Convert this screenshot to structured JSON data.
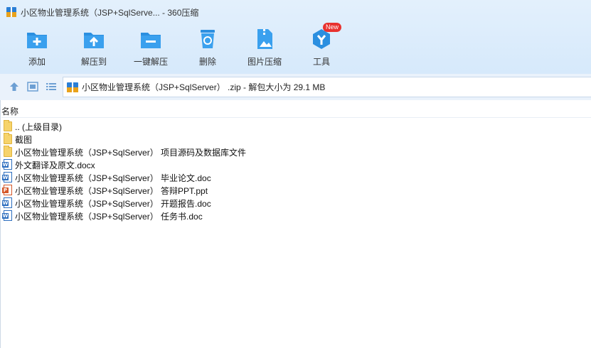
{
  "window": {
    "title": "小区物业管理系统（JSP+SqlServe... - 360压缩"
  },
  "toolbar": {
    "items": [
      {
        "label": "添加",
        "icon": "add-icon"
      },
      {
        "label": "解压到",
        "icon": "extract-to-icon"
      },
      {
        "label": "一键解压",
        "icon": "one-click-extract-icon"
      },
      {
        "label": "删除",
        "icon": "delete-icon"
      },
      {
        "label": "图片压缩",
        "icon": "image-compress-icon"
      },
      {
        "label": "工具",
        "icon": "tools-icon",
        "badge": "New"
      }
    ]
  },
  "address": {
    "text": "小区物业管理系统（JSP+SqlServer） .zip - 解包大小为 29.1 MB"
  },
  "list": {
    "column_header": "名称",
    "rows": [
      {
        "name": ".. (上级目录)",
        "type": "folder"
      },
      {
        "name": "截图",
        "type": "folder"
      },
      {
        "name": "小区物业管理系统（JSP+SqlServer） 项目源码及数据库文件",
        "type": "folder"
      },
      {
        "name": "外文翻译及原文.docx",
        "type": "word"
      },
      {
        "name": "小区物业管理系统（JSP+SqlServer） 毕业论文.doc",
        "type": "word"
      },
      {
        "name": "小区物业管理系统（JSP+SqlServer） 答辩PPT.ppt",
        "type": "ppt"
      },
      {
        "name": "小区物业管理系统（JSP+SqlServer） 开题报告.doc",
        "type": "word"
      },
      {
        "name": "小区物业管理系统（JSP+SqlServer） 任务书.doc",
        "type": "word"
      }
    ]
  },
  "colors": {
    "accent": "#2b8fe0",
    "header_bg": "#d9eafb",
    "badge": "#e8322f"
  }
}
